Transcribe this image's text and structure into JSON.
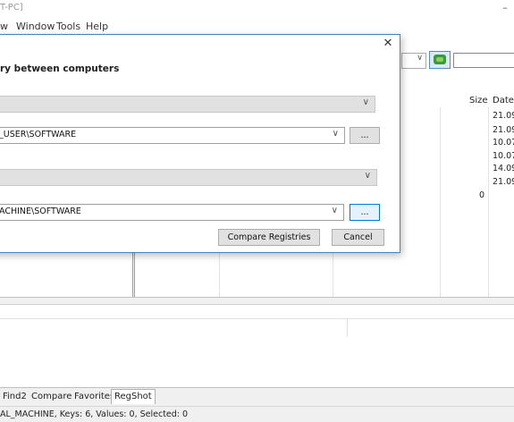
{
  "window": {
    "title_fragment": "T-PC]",
    "minimize": "–"
  },
  "menu": {
    "items": [
      "w",
      "Window",
      "Tools",
      "Help"
    ]
  },
  "toolbar": {
    "combo_chevron": "∨"
  },
  "list": {
    "headers": {
      "size": "Size",
      "date": "Date"
    },
    "dates": [
      "21.09.",
      "21.09.",
      "10.07.",
      "10.07.",
      "14.09.",
      "21.09."
    ],
    "size_value": "0"
  },
  "dialog": {
    "close": "✕",
    "heading": "ry between computers",
    "field1_value": "",
    "field2_value": "_USER\\SOFTWARE",
    "field3_value": "",
    "field4_value": "ACHINE\\SOFTWARE",
    "browse_label": "...",
    "compare_label": "Compare Registries",
    "cancel_label": "Cancel",
    "chevron": "∨"
  },
  "tabs": [
    "Find2",
    "Compare",
    "Favorites",
    "RegShot"
  ],
  "status": {
    "text": "AL_MACHINE, Keys: 6, Values: 0, Selected: 0"
  }
}
